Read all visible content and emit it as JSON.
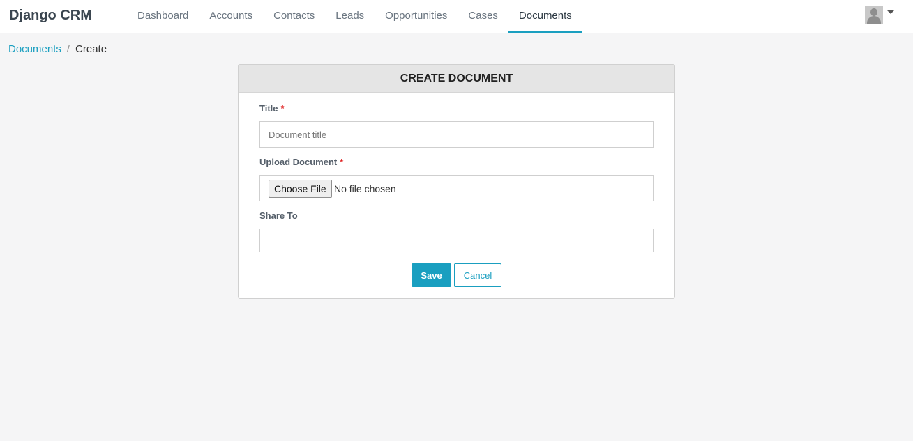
{
  "navbar": {
    "brand": "Django CRM",
    "items": [
      {
        "label": "Dashboard"
      },
      {
        "label": "Accounts"
      },
      {
        "label": "Contacts"
      },
      {
        "label": "Leads"
      },
      {
        "label": "Opportunities"
      },
      {
        "label": "Cases"
      },
      {
        "label": "Documents"
      }
    ],
    "active_item": "Documents",
    "user_icon": "user-avatar-icon"
  },
  "breadcrumb": {
    "link": "Documents",
    "separator": "/",
    "current": "Create"
  },
  "form": {
    "heading": "CREATE DOCUMENT",
    "title_label": "Title",
    "title_required": "*",
    "title_placeholder": "Document title",
    "title_value": "",
    "upload_label": "Upload Document",
    "upload_required": "*",
    "choose_file_label": "Choose File",
    "file_status": "No file chosen",
    "share_label": "Share To",
    "share_value": "",
    "save_label": "Save",
    "cancel_label": "Cancel"
  },
  "colors": {
    "accent": "#1a9fc0",
    "required": "#e02020",
    "background": "#f5f5f6"
  }
}
